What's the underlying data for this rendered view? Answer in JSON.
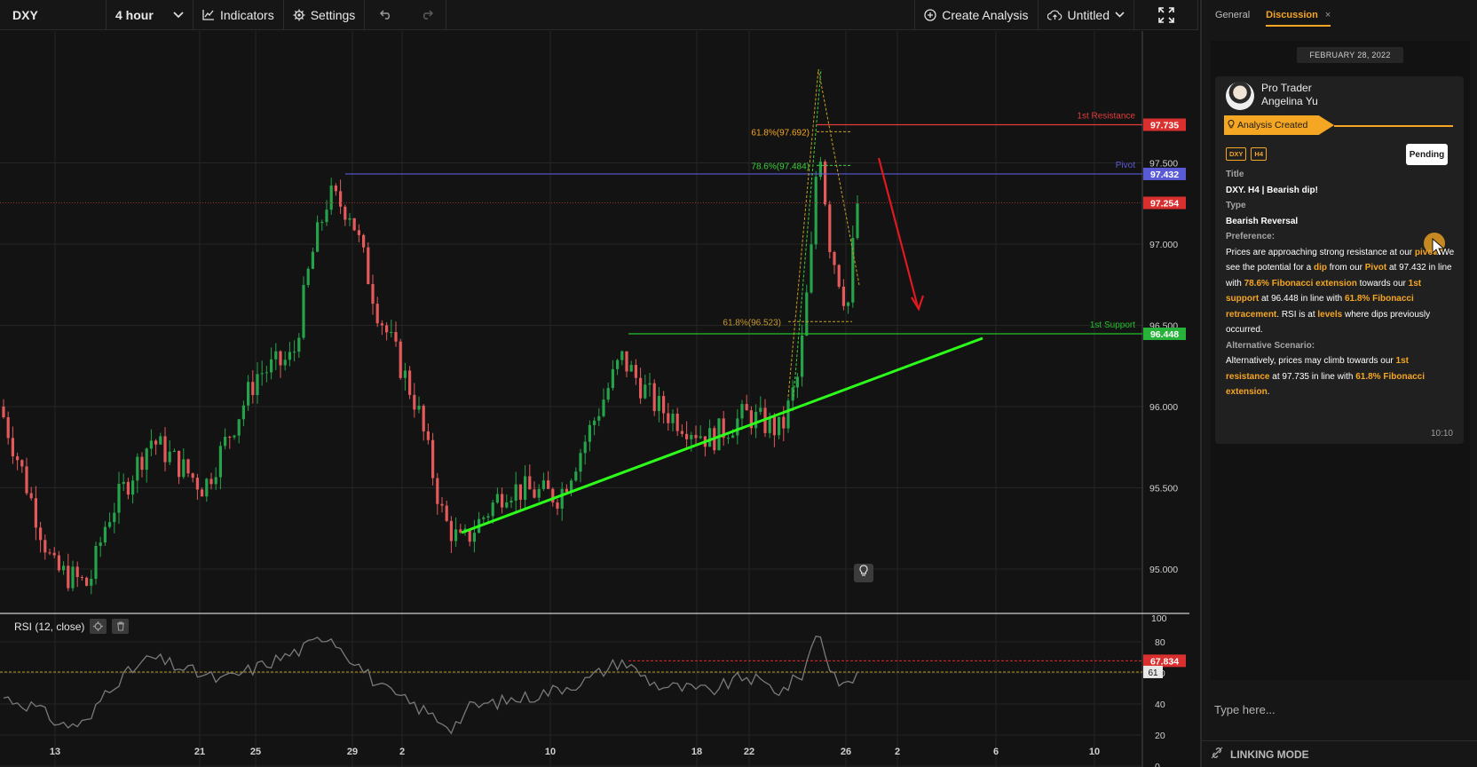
{
  "toolbar": {
    "symbol": "DXY",
    "interval": "4 hour",
    "indicators_label": "Indicators",
    "settings_label": "Settings",
    "create_analysis_label": "Create Analysis",
    "layout_name": "Untitled"
  },
  "chart": {
    "price_axis": [
      "97.500",
      "97.000",
      "96.500",
      "96.000",
      "95.500",
      "95.000"
    ],
    "time_axis": [
      "13",
      "21",
      "25",
      "29",
      "2",
      "10",
      "18",
      "22",
      "26",
      "2",
      "6",
      "10"
    ],
    "badges": {
      "resistance": "97.735",
      "pivot": "97.432",
      "last": "97.254",
      "support": "96.448"
    },
    "level_labels": {
      "resistance": "1st Resistance",
      "pivot": "Pivot",
      "support": "1st Support"
    },
    "fib_labels": {
      "ext_618": "61.8%(97.692)",
      "ext_786": "78.6%(97.484)",
      "ret_618": "61.8%(96.523)"
    },
    "colors": {
      "up": "#26a34a",
      "down": "#e45a5a",
      "resistance": "#e23b3b",
      "pivot": "#5a5ad6",
      "support": "#22c02a",
      "trend": "#2bff1a",
      "fib": "#f5a623",
      "rsi_line": "#7a7a7a"
    }
  },
  "rsi": {
    "legend": "RSI (12, close)",
    "axis": [
      "100",
      "80",
      "60",
      "40",
      "20",
      "0"
    ],
    "badge": "67.834",
    "badge2": "61"
  },
  "panel": {
    "tabs": {
      "general": "General",
      "discussion": "Discussion",
      "close": "×"
    },
    "date": "FEBRUARY 28, 2022",
    "author_line1": "Pro Trader",
    "author_line2": "Angelina Yu",
    "banner": "Analysis Created",
    "tag_symbol": "DXY",
    "tag_tf": "H4",
    "status": "Pending",
    "title_label": "Title",
    "title_value": "DXY. H4 | Bearish dip!",
    "type_label": "Type",
    "type_value": "Bearish Reversal",
    "preference_label": "Preference:",
    "pref": {
      "t1": "Prices are approaching strong resistance at our ",
      "h1": "pivot",
      "t2": ". We see the potential for a ",
      "h2": "dip",
      "t3": " from our ",
      "h3": "Pivot",
      "t4": " at 97.432 in line with ",
      "h4": "78.6% Fibonacci extension",
      "t5": " towards our ",
      "h5": "1st support",
      "t6": " at 96.448 in line with ",
      "h6": "61.8% Fibonacci retracement",
      "t7": ". RSI is at ",
      "h7": "levels",
      "t8": " where dips previously occurred."
    },
    "alt_label": "Alternative Scenario:",
    "alt": {
      "t1": "Alternatively, prices may climb towards our ",
      "h1": "1st resistance",
      "t2": " at 97.735 in line with ",
      "h2": "61.8% Fibonacci extension",
      "t3": "."
    },
    "time": "10:10",
    "input_placeholder": "Type here...",
    "linking_label": "LINKING MODE"
  }
}
